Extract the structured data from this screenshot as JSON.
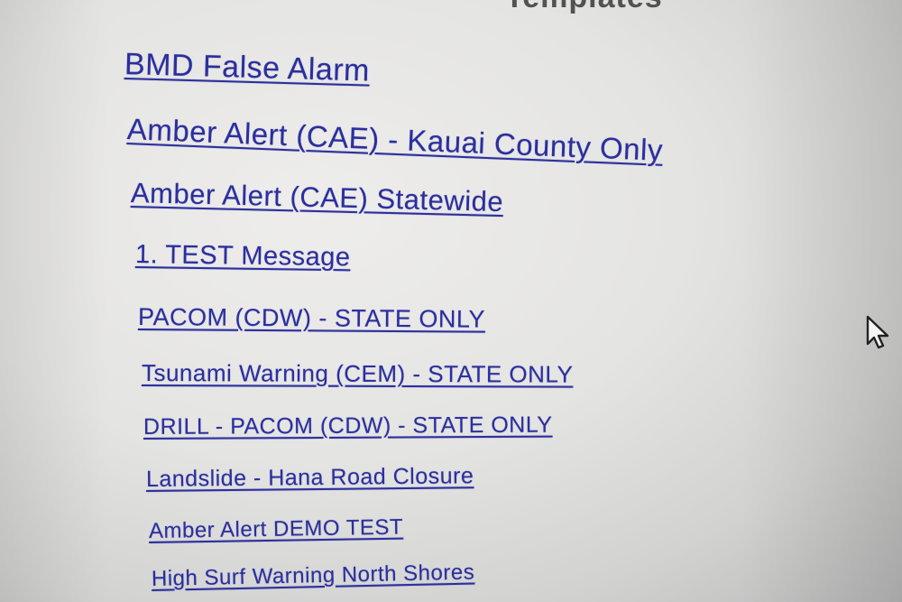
{
  "header": {
    "title": "Templates"
  },
  "templates": [
    {
      "label": "BMD False Alarm"
    },
    {
      "label": "Amber Alert (CAE) - Kauai County Only"
    },
    {
      "label": "Amber Alert (CAE) Statewide"
    },
    {
      "label": "1. TEST Message"
    },
    {
      "label": "PACOM (CDW) - STATE ONLY"
    },
    {
      "label": "Tsunami Warning (CEM) - STATE ONLY"
    },
    {
      "label": "DRILL - PACOM (CDW) - STATE ONLY"
    },
    {
      "label": "Landslide - Hana Road Closure"
    },
    {
      "label": "Amber Alert DEMO TEST"
    },
    {
      "label": "High Surf Warning North Shores"
    }
  ],
  "colors": {
    "link": "#2b2f9e",
    "background": "#e4e4e2"
  },
  "icons": {
    "cursor": "mouse-pointer-icon"
  }
}
